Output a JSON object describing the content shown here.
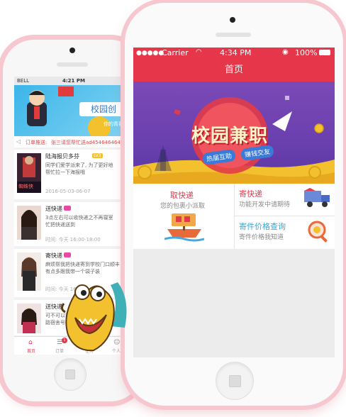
{
  "back_app": {
    "status": {
      "carrier": "BELL",
      "time": "4:21 PM"
    },
    "banner": {
      "text": "校园创",
      "sub": "你的青春"
    },
    "notice": {
      "label": "订单推送:",
      "text": "张三请您帮忙送ad454646464"
    },
    "cards": [
      {
        "title": "陆海报贝多芬",
        "badge": "LV3",
        "text1": "同学们爱学派来了, 为了更好地",
        "text2": "帮忙拉一下海报哦",
        "time": "2016-05-03-06-07",
        "poster": "蜘蛛侠"
      },
      {
        "title": "送快递",
        "text1": "3点左右可以收快递之不再寝室",
        "text2": "忙把快递送到",
        "time": "时间: 今天 16:00-18:00"
      },
      {
        "title": "寄快递",
        "text1": "麻烦帮我把快递寄到学校门口顺丰",
        "text2": "有点多跟我带一个袋子装",
        "time": "时间: 今天 16:00-18:00"
      },
      {
        "title": "送快递",
        "text1": "可不可以帮我拿一个快递帮忙",
        "text2": "路宿舍号4栋909",
        "time": ""
      }
    ],
    "tabs": [
      "首页",
      "订单",
      "任务",
      "个人"
    ],
    "tab_badge": "1"
  },
  "front_app": {
    "status": {
      "carrier": "Carrier",
      "time": "4:34 PM",
      "battery": "100%"
    },
    "nav_title": "首页",
    "banner": {
      "headline": "校园兼职",
      "tag1": "热届互助",
      "tag2": "赚钱交友"
    },
    "services": [
      {
        "title": "取快递",
        "subtitle": "您的包裹小派取",
        "color": "#e6374a"
      },
      {
        "title": "寄快递",
        "subtitle": "功能开发中请期待",
        "color": "#e6374a"
      },
      {
        "title": "寄件价格查询",
        "subtitle": "寄件价格我知道",
        "color": "#3aa6d8"
      }
    ]
  },
  "colors": {
    "brand": "#e6374a",
    "banner": "#6a3fae",
    "accent_blue": "#3aa6d8",
    "phone_shadow": "#f6c7ce"
  }
}
